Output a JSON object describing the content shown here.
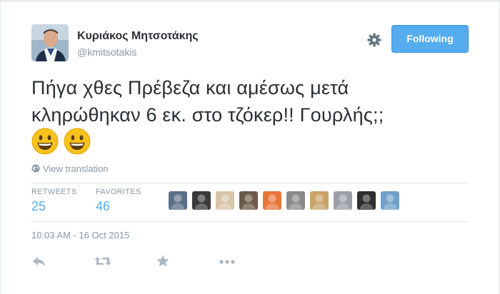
{
  "user": {
    "name": "Κυριάκος Μητσοτάκης",
    "handle": "@kmitsotakis"
  },
  "header": {
    "follow_label": "Following",
    "gear_icon": "gear-icon"
  },
  "tweet": {
    "line1": "Πήγα χθες Πρέβεζα και αμέσως μετά",
    "line2": "κληρώθηκαν 6 εκ. στο τζόκερ!! Γουρλής;;",
    "emojis": [
      "smiley-icon",
      "smiley-icon"
    ]
  },
  "translate": {
    "label": "View translation",
    "icon": "globe-icon"
  },
  "stats": {
    "retweets_label": "RETWEETS",
    "retweets": "25",
    "favorites_label": "FAVORITES",
    "favorites": "46"
  },
  "favoriters": [
    {
      "color": "#5b6f86"
    },
    {
      "color": "#3a3a3a"
    },
    {
      "color": "#d8c4a8"
    },
    {
      "color": "#6b5a4a"
    },
    {
      "color": "#e8763a"
    },
    {
      "color": "#8a8a8a"
    },
    {
      "color": "#c9a36a"
    },
    {
      "color": "#9aa0a6"
    },
    {
      "color": "#2f2f2f"
    },
    {
      "color": "#6fa0c8"
    }
  ],
  "timestamp": "10:03 AM - 16 Oct 2015",
  "actions": [
    "reply-icon",
    "retweet-icon",
    "favorite-icon",
    "more-icon"
  ],
  "colors": {
    "accent": "#55acee",
    "text": "#292f33",
    "muted": "#8899a6",
    "emoji_yellow": "#f7c21c"
  }
}
